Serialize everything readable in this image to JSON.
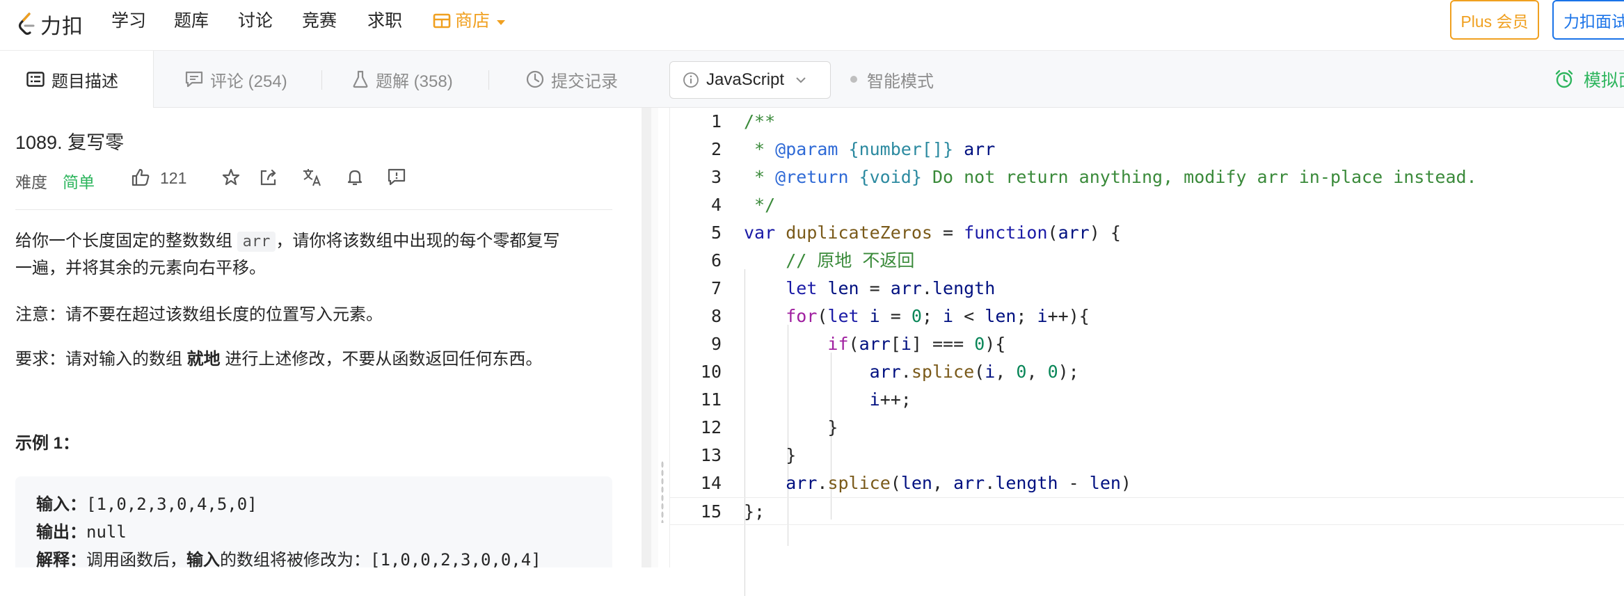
{
  "nav": {
    "logo_text": "力扣",
    "links": [
      "学习",
      "题库",
      "讨论",
      "竞赛",
      "求职"
    ],
    "shop": "商店",
    "plus_label": "Plus 会员",
    "ide_label": "力扣面试"
  },
  "tabs": {
    "description": "题目描述",
    "comments": "评论 (254)",
    "solutions": "题解 (358)",
    "submissions": "提交记录",
    "language": "JavaScript",
    "smart_mode": "智能模式",
    "mock": "模拟面试"
  },
  "problem": {
    "title": "1089. 复写零",
    "difficulty_label": "难度",
    "difficulty": "简单",
    "likes": "121",
    "desc_p1_a": "给你一个长度固定的整数数组 ",
    "desc_p1_code": "arr",
    "desc_p1_b": "，请你将该数组中出现的每个零都复写",
    "desc_p1_c": "一遍，并将其余的元素向右平移。",
    "note": "注意：请不要在超过该数组长度的位置写入元素。",
    "req_a": "要求：请对输入的数组 ",
    "req_bold": "就地",
    "req_b": " 进行上述修改，不要从函数返回任何东西。",
    "example_title": "示例 1：",
    "ex_input_label": "输入：",
    "ex_input": "[1,0,2,3,0,4,5,0]",
    "ex_output_label": "输出：",
    "ex_output": "null",
    "ex_explain_label": "解释：",
    "ex_explain_a": "调用函数后，",
    "ex_explain_bold": "输入",
    "ex_explain_b": "的数组将被修改为：",
    "ex_explain_val": "[1,0,0,2,3,0,0,4]"
  },
  "code": {
    "line_numbers": [
      "1",
      "2",
      "3",
      "4",
      "5",
      "6",
      "7",
      "8",
      "9",
      "10",
      "11",
      "12",
      "13",
      "14",
      "15"
    ]
  },
  "colors": {
    "accent_orange": "#f0a020",
    "accent_blue": "#1a73e8",
    "easy_green": "#2db55d"
  }
}
